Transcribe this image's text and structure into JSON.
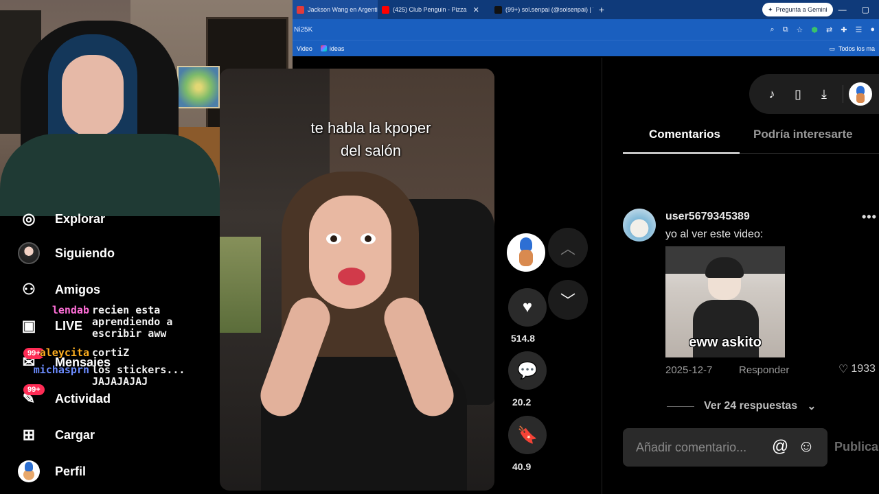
{
  "browser": {
    "tabs": [
      {
        "label": "Jackson Wang en Argentin",
        "fav_color": "#e23b3b"
      },
      {
        "label": "(425) Club Penguin - Pizza",
        "fav_color": "#ff0000"
      },
      {
        "label": "(99+) sol.senpai (@solsenpai) | T",
        "fav_color": "#111111"
      }
    ],
    "gemini_label": "Pregunta a Gemini",
    "address": "Ni25K",
    "bookmarks": [
      {
        "label": "Video"
      },
      {
        "label": "ideas"
      }
    ],
    "bookmarks_right": "Todos los ma"
  },
  "sidebar": {
    "items": [
      {
        "label": "Explorar",
        "icon": "compass-icon"
      },
      {
        "label": "Siguiendo",
        "icon": "avatar-icon"
      },
      {
        "label": "Amigos",
        "icon": "friends-icon"
      },
      {
        "label": "LIVE",
        "icon": "live-icon"
      },
      {
        "label": "Mensajes",
        "icon": "messages-icon",
        "badge": "99+"
      },
      {
        "label": "Actividad",
        "icon": "activity-icon",
        "badge": "99+"
      },
      {
        "label": "Cargar",
        "icon": "upload-icon"
      },
      {
        "label": "Perfil",
        "icon": "profile-avatar-icon"
      }
    ]
  },
  "chat": [
    {
      "user": "lendab",
      "color": "#ff6fd8",
      "message": "recien esta\naprendiendo a\nescribir aww"
    },
    {
      "user": "aleycita",
      "color": "#ffb020",
      "message": "cortiZ"
    },
    {
      "user": "michasprn",
      "color": "#6c8cff",
      "message": "los stickers...\nJAJAJAJAJ"
    }
  ],
  "video": {
    "caption_line1": "te habla la kpoper",
    "caption_line2": "del salón",
    "likes": "514.8",
    "comments": "20.2",
    "saves": "40.9"
  },
  "panel": {
    "tab_comments": "Comentarios",
    "tab_interest": "Podría interesarte",
    "comment": {
      "user": "user5679345389",
      "text": "yo al ver este video:",
      "image_text": "eww askito",
      "date": "2025-12-7",
      "reply": "Responder",
      "likes": "1933"
    },
    "view_replies": "Ver 24 respuestas",
    "input_placeholder": "Añadir comentario...",
    "publish": "Publica"
  },
  "colors": {
    "accent": "#fe2c55",
    "browser_blue": "#1a5fbf"
  }
}
